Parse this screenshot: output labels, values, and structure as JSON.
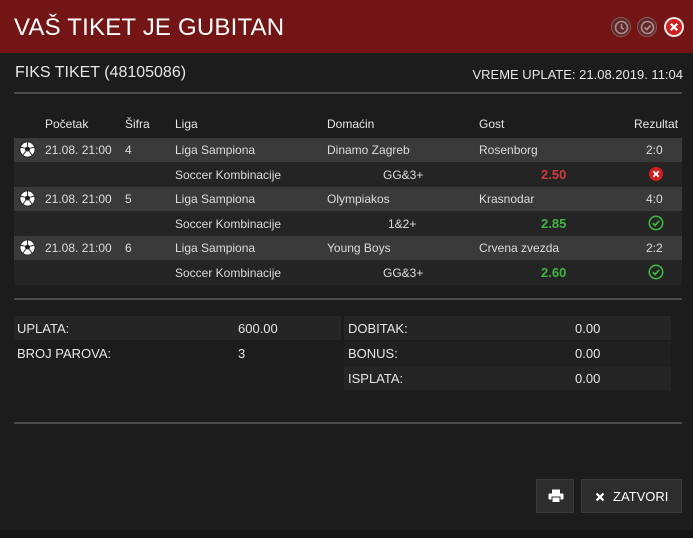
{
  "dialog": {
    "title": "VAŠ TIKET JE GUBITAN",
    "ticket_label": "FIKS TIKET (48105086)",
    "payment_time": "VREME UPLATE: 21.08.2019. 11:04"
  },
  "table": {
    "headers": [
      "Početak",
      "Šifra",
      "Liga",
      "Domaćin",
      "Gost",
      "Rezultat"
    ],
    "rows": [
      {
        "start": "21.08. 21:00",
        "code": "4",
        "league": "Liga Sampiona",
        "home": "Dinamo Zagreb",
        "away": "Rosenborg",
        "result": "2:0",
        "bet_type": "Soccer Kombinacije",
        "pick": "GG&3+",
        "odds": "2.50",
        "status": "lost"
      },
      {
        "start": "21.08. 21:00",
        "code": "5",
        "league": "Liga Sampiona",
        "home": "Olympiakos",
        "away": "Krasnodar",
        "result": "4:0",
        "bet_type": "Soccer Kombinacije",
        "pick": "1&2+",
        "odds": "2.85",
        "status": "won"
      },
      {
        "start": "21.08. 21:00",
        "code": "6",
        "league": "Liga Sampiona",
        "home": "Young Boys",
        "away": "Crvena zvezda",
        "result": "2:2",
        "bet_type": "Soccer Kombinacije",
        "pick": "GG&3+",
        "odds": "2.60",
        "status": "won"
      }
    ]
  },
  "summary": {
    "uplata_label": "UPLATA:",
    "uplata_value": "600.00",
    "broj_parova_label": "BROJ PAROVA:",
    "broj_parova_value": "3",
    "dobitak_label": "DOBITAK:",
    "dobitak_value": "0.00",
    "bonus_label": "BONUS:",
    "bonus_value": "0.00",
    "isplata_label": "ISPLATA:",
    "isplata_value": "0.00"
  },
  "buttons": {
    "close_label": "ZATVORI"
  },
  "colors": {
    "title_bg": "#741515",
    "lost": "#d23b3b",
    "won": "#3fb43f"
  }
}
